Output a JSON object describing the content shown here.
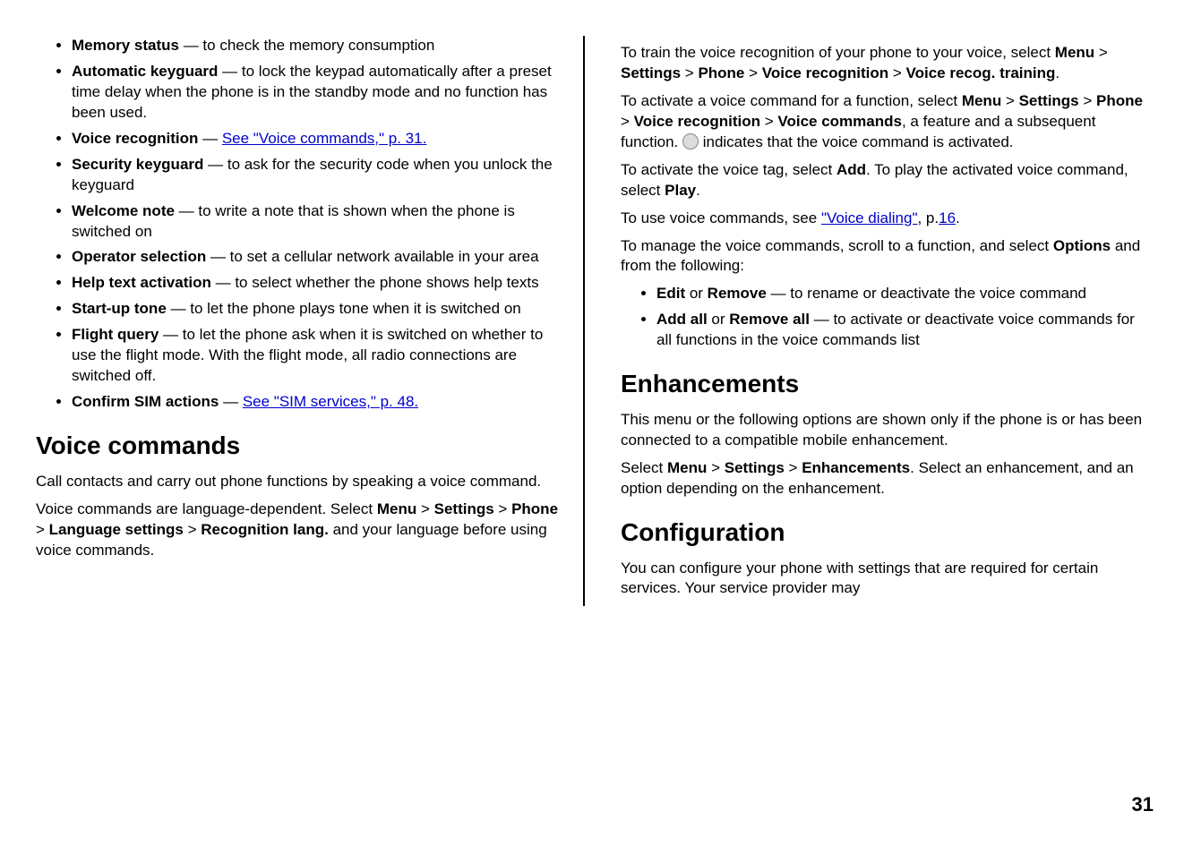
{
  "left": {
    "items": [
      {
        "label": "Memory status",
        "desc": " — to check the memory consumption"
      },
      {
        "label": "Automatic keyguard",
        "desc": " — to lock the keypad automatically after a preset time delay when the phone is in the standby mode and no function has been used."
      },
      {
        "label": "Voice recognition",
        "desc": " — ",
        "link": "See \"Voice commands,\" p. 31."
      },
      {
        "label": "Security keyguard",
        "desc": " — to ask for the security code when you unlock the keyguard"
      },
      {
        "label": "Welcome note",
        "desc": " — to write a note that is shown when the phone is switched on"
      },
      {
        "label": "Operator selection",
        "desc": " —  to set a cellular network available in your area"
      },
      {
        "label": "Help text activation",
        "desc": " — to select whether the phone shows help texts"
      },
      {
        "label": "Start-up tone",
        "desc": " — to let the phone plays tone when it is switched on"
      },
      {
        "label": "Flight query",
        "desc": " — to let the phone ask when it is switched on whether to use the flight mode. With the flight mode, all radio connections are switched off."
      },
      {
        "label": "Confirm SIM actions",
        "desc": " —  ",
        "link": "See \"SIM services,\" p. 48."
      }
    ],
    "voice_commands_heading": "Voice commands",
    "vc_intro": "Call contacts and carry out phone functions by speaking a voice command.",
    "vc_lang_pre": "Voice commands are language-dependent. Select ",
    "vc_path_menu": "Menu",
    "vc_path_settings": "Settings",
    "vc_path_phone": "Phone",
    "vc_path_langset": "Language settings",
    "vc_path_recog": "Recognition lang.",
    "vc_lang_post": " and your language before using voice commands."
  },
  "right": {
    "train_pre": "To train the voice recognition of your phone to your voice, select ",
    "train_path": {
      "menu": "Menu",
      "settings": "Settings",
      "phone": "Phone",
      "vr": "Voice recognition",
      "vrt": "Voice recog. training"
    },
    "activate_pre": "To activate a voice command for a function, select ",
    "activate_path": {
      "menu": "Menu",
      "settings": "Settings",
      "phone": "Phone",
      "vr": "Voice recognition",
      "vc": "Voice commands"
    },
    "activate_mid": ", a feature and a subsequent function. ",
    "activate_post": " indicates that the voice command is activated.",
    "tag_pre": "To activate the voice tag, select ",
    "tag_add": "Add",
    "tag_mid": ". To play the activated voice command, select ",
    "tag_play": "Play",
    "use_pre": "To use voice commands, see ",
    "use_link": "\"Voice dialing\"",
    "use_mid": ", p.",
    "use_pagelink": "16",
    "use_post": ".",
    "manage_pre": "To manage the voice commands, scroll to a function, and select ",
    "manage_options": "Options",
    "manage_post": " and from the following:",
    "manage_items": [
      {
        "l1": "Edit",
        "or": " or ",
        "l2": "Remove",
        "desc": " — to rename or deactivate the voice command"
      },
      {
        "l1": "Add all",
        "or": " or ",
        "l2": "Remove all",
        "desc": " — to activate or deactivate voice commands for all functions in the voice commands list"
      }
    ],
    "enh_heading": "Enhancements",
    "enh_intro": "This menu or the following options are shown only if the phone is or has been connected to a compatible mobile enhancement.",
    "enh_select_pre": "Select ",
    "enh_path": {
      "menu": "Menu",
      "settings": "Settings",
      "enh": "Enhancements"
    },
    "enh_select_post": ". Select an enhancement, and an option depending on the enhancement.",
    "cfg_heading": "Configuration",
    "cfg_text": "You can configure your phone with settings that are required for certain services. Your service provider may"
  },
  "sep": " > ",
  "page_number": "31"
}
